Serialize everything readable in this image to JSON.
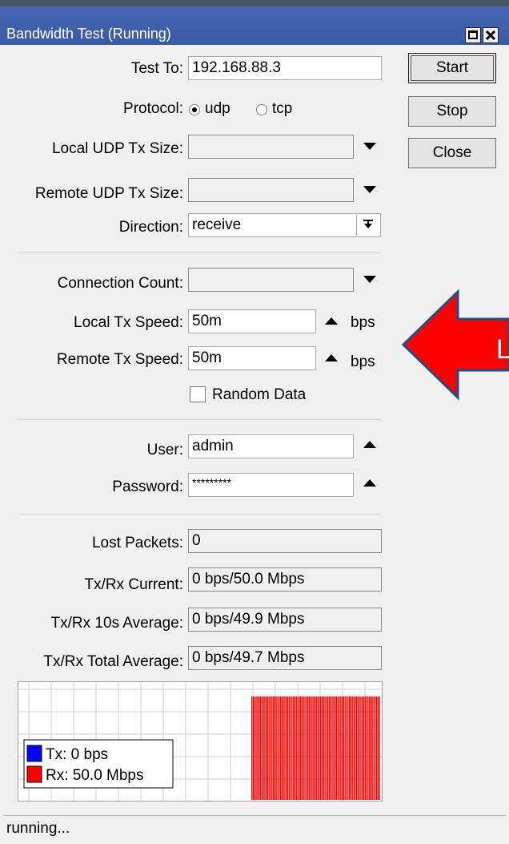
{
  "window": {
    "title": "Bandwidth Test (Running)"
  },
  "buttons": {
    "start": "Start",
    "stop": "Stop",
    "close": "Close"
  },
  "form": {
    "test_to": {
      "label": "Test To:",
      "value": "192.168.88.3"
    },
    "protocol": {
      "label": "Protocol:",
      "options": [
        "udp",
        "tcp"
      ],
      "selected": "udp"
    },
    "local_udp_tx_size": {
      "label": "Local UDP Tx Size:",
      "value": ""
    },
    "remote_udp_tx_size": {
      "label": "Remote UDP Tx Size:",
      "value": ""
    },
    "direction": {
      "label": "Direction:",
      "value": "receive"
    },
    "connection_count": {
      "label": "Connection Count:",
      "value": ""
    },
    "local_tx_speed": {
      "label": "Local Tx Speed:",
      "value": "50m",
      "unit": "bps"
    },
    "remote_tx_speed": {
      "label": "Remote Tx Speed:",
      "value": "50m",
      "unit": "bps"
    },
    "random_data": {
      "label": "Random Data",
      "checked": false
    },
    "user": {
      "label": "User:",
      "value": "admin"
    },
    "password": {
      "label": "Password:",
      "value": "*********"
    }
  },
  "stats": {
    "lost_packets": {
      "label": "Lost Packets:",
      "value": "0"
    },
    "txrx_current": {
      "label": "Tx/Rx Current:",
      "value": "0 bps/50.0 Mbps"
    },
    "txrx_10s_avg": {
      "label": "Tx/Rx 10s Average:",
      "value": "0 bps/49.9 Mbps"
    },
    "txrx_total_avg": {
      "label": "Tx/Rx Total Average:",
      "value": "0 bps/49.7 Mbps"
    }
  },
  "chart_data": {
    "type": "bar",
    "series": [
      {
        "name": "Tx",
        "color": "#0000ff",
        "legend": "Tx:  0 bps",
        "values": []
      },
      {
        "name": "Rx",
        "color": "#ff0000",
        "legend": "Rx:  50.0 Mbps",
        "values": [
          50,
          50,
          50,
          50,
          50,
          50,
          50,
          50,
          50,
          50,
          50,
          50,
          50,
          50,
          50,
          50,
          50,
          50,
          50,
          50,
          50,
          50,
          50,
          50,
          50,
          50,
          50,
          50,
          50,
          50,
          50,
          50,
          50,
          50,
          50,
          50,
          50,
          50,
          50,
          50,
          50,
          50,
          50,
          50,
          50,
          50,
          50,
          50,
          50,
          50,
          50,
          50,
          50,
          50,
          50,
          50,
          50,
          50,
          50,
          50,
          50,
          50,
          50,
          50,
          50,
          50,
          50,
          50,
          50,
          50,
          50,
          50,
          50,
          50,
          50,
          50,
          50,
          50,
          50,
          50,
          50,
          50,
          50,
          50,
          50,
          50,
          50,
          50,
          50,
          50
        ]
      }
    ],
    "idle_fraction": 0.62,
    "grid": true
  },
  "annotation": {
    "arrow_color": "#ff0000",
    "text": "L"
  },
  "status": {
    "text": "running..."
  }
}
